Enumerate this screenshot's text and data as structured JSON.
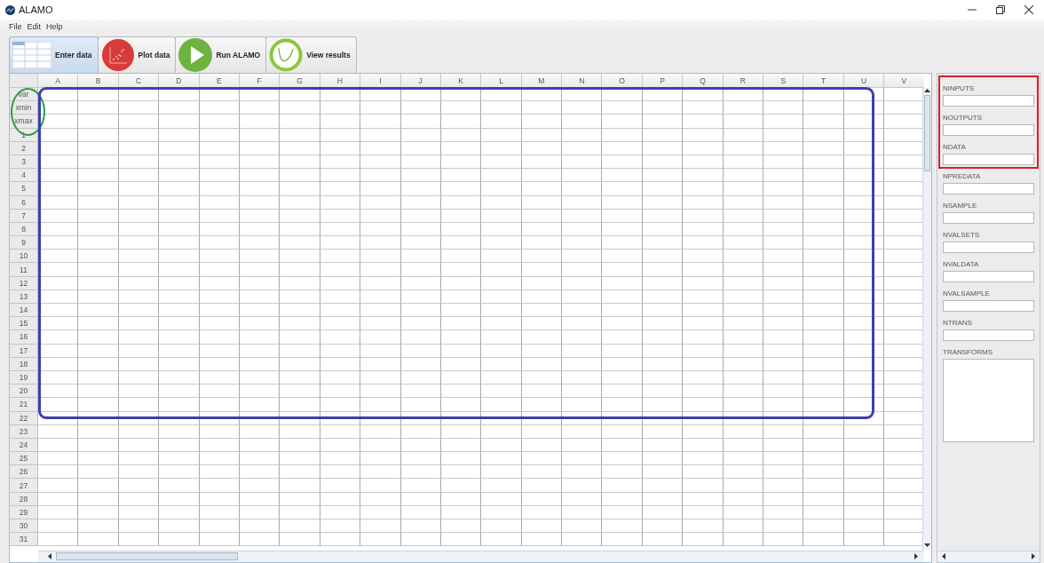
{
  "window": {
    "title": "ALAMO"
  },
  "menu": [
    "File",
    "Edit",
    "Help"
  ],
  "tabs": [
    {
      "label": "Enter data",
      "kind": "table",
      "selected": true
    },
    {
      "label": "Plot data",
      "kind": "plot",
      "selected": false
    },
    {
      "label": "Run ALAMO",
      "kind": "run",
      "selected": false
    },
    {
      "label": "View results",
      "kind": "results",
      "selected": false
    }
  ],
  "grid": {
    "columns": [
      "A",
      "B",
      "C",
      "D",
      "E",
      "F",
      "G",
      "H",
      "I",
      "J",
      "K",
      "L",
      "M",
      "N",
      "O",
      "P",
      "Q",
      "R",
      "S",
      "T",
      "U",
      "V"
    ],
    "rows": [
      "var",
      "xmin",
      "xmax",
      "1",
      "2",
      "3",
      "4",
      "5",
      "6",
      "7",
      "8",
      "9",
      "10",
      "11",
      "12",
      "13",
      "14",
      "15",
      "16",
      "17",
      "18",
      "19",
      "20",
      "21",
      "22",
      "23",
      "24",
      "25",
      "26",
      "27",
      "28",
      "29",
      "30",
      "31"
    ]
  },
  "parameters": [
    {
      "label": "NINPUTS",
      "kind": "field"
    },
    {
      "label": "NOUTPUTS",
      "kind": "field"
    },
    {
      "label": "NDATA",
      "kind": "field"
    },
    {
      "label": "NPREDATA",
      "kind": "field"
    },
    {
      "label": "NSAMPLE",
      "kind": "field"
    },
    {
      "label": "NVALSETS",
      "kind": "field"
    },
    {
      "label": "NVALDATA",
      "kind": "field"
    },
    {
      "label": "NVALSAMPLE",
      "kind": "field"
    },
    {
      "label": "NTRANS",
      "kind": "field"
    },
    {
      "label": "TRANSFORMS",
      "kind": "area"
    }
  ],
  "annotations": [
    {
      "kind": "ellipse",
      "color": "#2f9a45"
    },
    {
      "kind": "rounded-rect",
      "color": "#3d3fb0"
    },
    {
      "kind": "rect",
      "color": "#d21f2b"
    }
  ]
}
